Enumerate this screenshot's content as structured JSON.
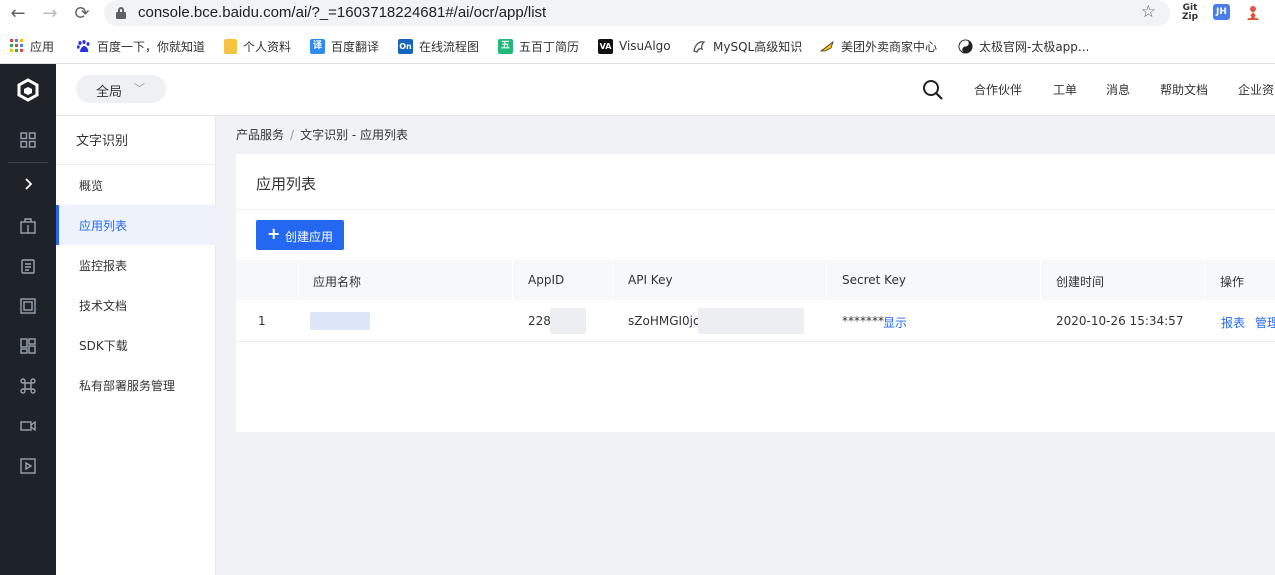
{
  "browser": {
    "url": "console.bce.baidu.com/ai/?_=1603718224681#/ai/ocr/app/list",
    "extensions": [
      "Git Zip",
      "JH"
    ]
  },
  "bookmarks": [
    {
      "label": "应用",
      "icon": "apps-grid-icon",
      "color": "#e8453c"
    },
    {
      "label": "百度一下，你就知道",
      "icon": "baidu-paw-icon",
      "color": "#2932e1"
    },
    {
      "label": "个人资料",
      "icon": "folder-icon",
      "color": "#f6c343"
    },
    {
      "label": "百度翻译",
      "icon": "translate-icon",
      "color": "#2d8cf0",
      "glyph": "译"
    },
    {
      "label": "在线流程图",
      "icon": "processon-icon",
      "color": "#1565c0",
      "glyph": "On"
    },
    {
      "label": "五百丁简历",
      "icon": "wubaiding-icon",
      "color": "#21b97a",
      "glyph": "五"
    },
    {
      "label": "VisuAlgo",
      "icon": "visualgo-icon",
      "color": "#111111",
      "glyph": "VA"
    },
    {
      "label": "MySQL高级知识",
      "icon": "mysql-dolphin-icon",
      "color": "#555555"
    },
    {
      "label": "美团外卖商家中心",
      "icon": "meituan-icon",
      "color": "#ffc300"
    },
    {
      "label": "太极官网-太极app...",
      "icon": "taiji-icon",
      "color": "#222222"
    }
  ],
  "header": {
    "scope_label": "全局",
    "links": [
      "合作伙伴",
      "工单",
      "消息",
      "帮助文档",
      "企业资"
    ]
  },
  "sidebar": {
    "title": "文字识别",
    "items": [
      {
        "label": "概览",
        "active": false
      },
      {
        "label": "应用列表",
        "active": true
      },
      {
        "label": "监控报表",
        "active": false
      },
      {
        "label": "技术文档",
        "active": false
      },
      {
        "label": "SDK下载",
        "active": false
      },
      {
        "label": "私有部署服务管理",
        "active": false
      }
    ]
  },
  "breadcrumb": {
    "parent": "产品服务",
    "separator": "/",
    "current": "文字识别 - 应用列表"
  },
  "main": {
    "title": "应用列表",
    "create_button": "创建应用",
    "table": {
      "columns": [
        "应用名称",
        "AppID",
        "API Key",
        "Secret Key",
        "创建时间",
        "操作"
      ],
      "rows": [
        {
          "index": "1",
          "name": "",
          "app_id": "228",
          "api_key": "sZoHMGI0jo",
          "secret_masked": "*******",
          "secret_show": "显示",
          "created": "2020-10-26 15:34:57",
          "actions": [
            "报表",
            "管理"
          ]
        }
      ]
    }
  },
  "colors": {
    "accent": "#2468f2",
    "rail": "#1e2329",
    "page_bg": "#f0f2f5"
  }
}
